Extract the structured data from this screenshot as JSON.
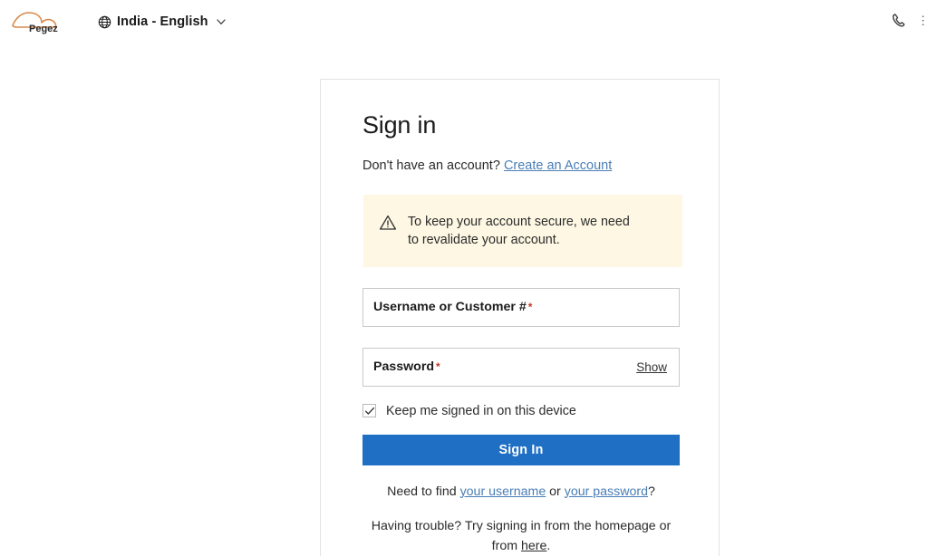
{
  "header": {
    "brand_name": "Pegez",
    "brand_icon": "cloud-swoosh-logo",
    "locale": {
      "globe_icon": "globe-icon",
      "label": "India - English",
      "chevron_icon": "chevron-down-icon"
    },
    "phone_icon": "phone-icon"
  },
  "signin": {
    "title": "Sign in",
    "account_prompt_text": "Don't have an account?",
    "create_account_link": "Create an Account",
    "alert": {
      "icon": "warning-triangle-icon",
      "message": "To keep your account secure, we need to revalidate your account."
    },
    "username_field": {
      "label": "Username or Customer #",
      "required_mark": "*",
      "value": "",
      "placeholder": ""
    },
    "password_field": {
      "label": "Password",
      "required_mark": "*",
      "value": "",
      "placeholder": "",
      "show_toggle": "Show"
    },
    "keep_signed_in": {
      "label": "Keep me signed in on this device",
      "checked": true,
      "check_icon": "check-icon"
    },
    "submit_label": "Sign In",
    "help_find": {
      "prefix": "Need to find ",
      "username_link": "your username",
      "middle": " or ",
      "password_link": "your password",
      "suffix": "?"
    },
    "help_trouble": {
      "prefix": "Having trouble? Try signing in from the homepage or from ",
      "here_link": "here",
      "suffix": "."
    }
  },
  "colors": {
    "accent_blue": "#1f6fc4",
    "link_blue": "#4a7eb5",
    "alert_background": "#fdf7e3",
    "required_red": "#c0392b",
    "border_gray": "#c9c9c9",
    "card_border": "#e3e3e3"
  }
}
